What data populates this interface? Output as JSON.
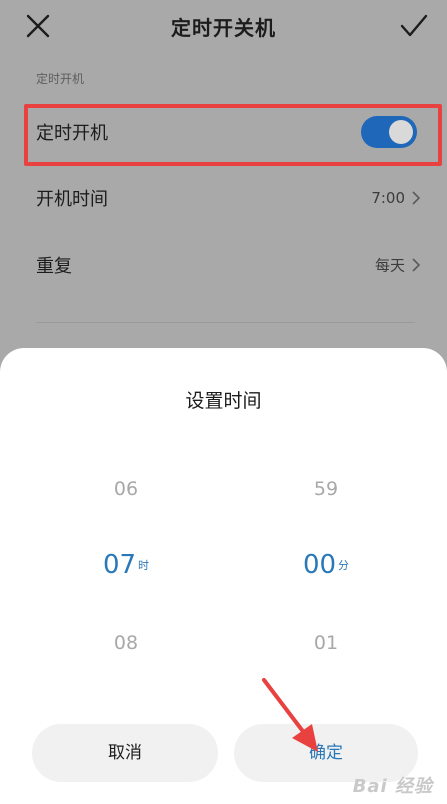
{
  "header": {
    "title": "定时开关机",
    "close_icon": "close-icon",
    "confirm_icon": "check-icon"
  },
  "section": {
    "label": "定时开机"
  },
  "rows": {
    "auto_boot": {
      "label": "定时开机",
      "toggle_on": true
    },
    "boot_time": {
      "label": "开机时间",
      "value": "7:00"
    },
    "repeat": {
      "label": "重复",
      "value": "每天"
    }
  },
  "sheet": {
    "title": "设置时间",
    "hours": {
      "prev": "06",
      "selected": "07",
      "unit": "时",
      "next": "08"
    },
    "minutes": {
      "prev": "59",
      "selected": "00",
      "unit": "分",
      "next": "01"
    },
    "cancel_label": "取消",
    "confirm_label": "确定"
  },
  "watermark": "Bai 经验",
  "colors": {
    "accent": "#2a78b8",
    "toggle": "#1f67b8",
    "highlight": "#e8413f",
    "arrow": "#e8413f",
    "overlay": "#a9a9a9"
  }
}
